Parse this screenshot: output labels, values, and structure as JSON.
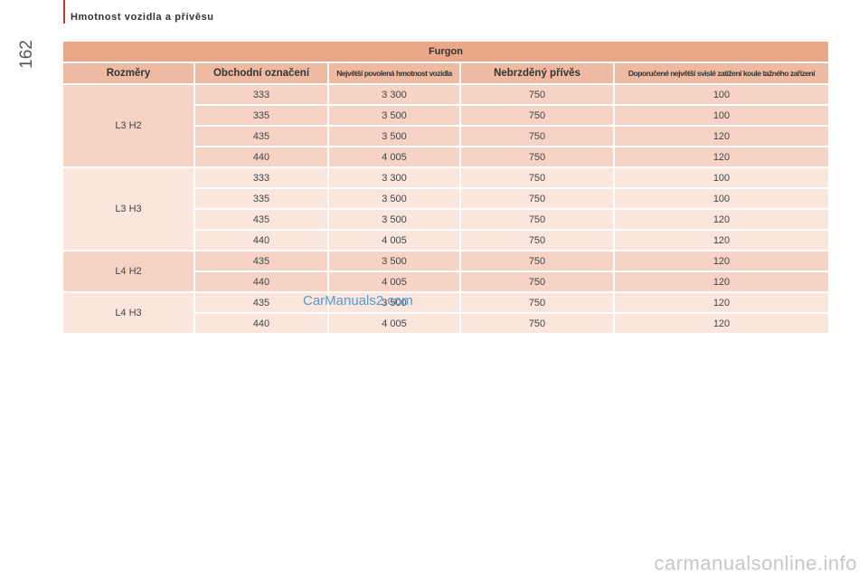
{
  "header": {
    "page_number": "162",
    "section_title": "Hmotnost vozidla a přívěsu"
  },
  "table": {
    "title": "Furgon",
    "columns": [
      "Rozměry",
      "Obchodní označení",
      "Největší povolená hmotnost vozidla",
      "Nebrzděný přívěs",
      "Doporučené největší svislé zatížení koule tažného zařízení"
    ],
    "groups": [
      {
        "dimension": "L3 H2",
        "rows": [
          [
            "333",
            "3 300",
            "750",
            "100"
          ],
          [
            "335",
            "3 500",
            "750",
            "100"
          ],
          [
            "435",
            "3 500",
            "750",
            "120"
          ],
          [
            "440",
            "4 005",
            "750",
            "120"
          ]
        ]
      },
      {
        "dimension": "L3 H3",
        "rows": [
          [
            "333",
            "3 300",
            "750",
            "100"
          ],
          [
            "335",
            "3 500",
            "750",
            "100"
          ],
          [
            "435",
            "3 500",
            "750",
            "120"
          ],
          [
            "440",
            "4 005",
            "750",
            "120"
          ]
        ]
      },
      {
        "dimension": "L4 H2",
        "rows": [
          [
            "435",
            "3 500",
            "750",
            "120"
          ],
          [
            "440",
            "4 005",
            "750",
            "120"
          ]
        ]
      },
      {
        "dimension": "L4 H3",
        "rows": [
          [
            "435",
            "3 500",
            "750",
            "120"
          ],
          [
            "440",
            "4 005",
            "750",
            "120"
          ]
        ]
      }
    ]
  },
  "watermarks": {
    "inline": "CarManuals2.com",
    "footer": "carmanualsonline.info"
  },
  "colors": {
    "title_row": "#e9a88a",
    "header_row": "#efbaa2",
    "group_dark": "#f6d3c4",
    "group_light": "#fae6dd",
    "accent": "#c0392b"
  }
}
